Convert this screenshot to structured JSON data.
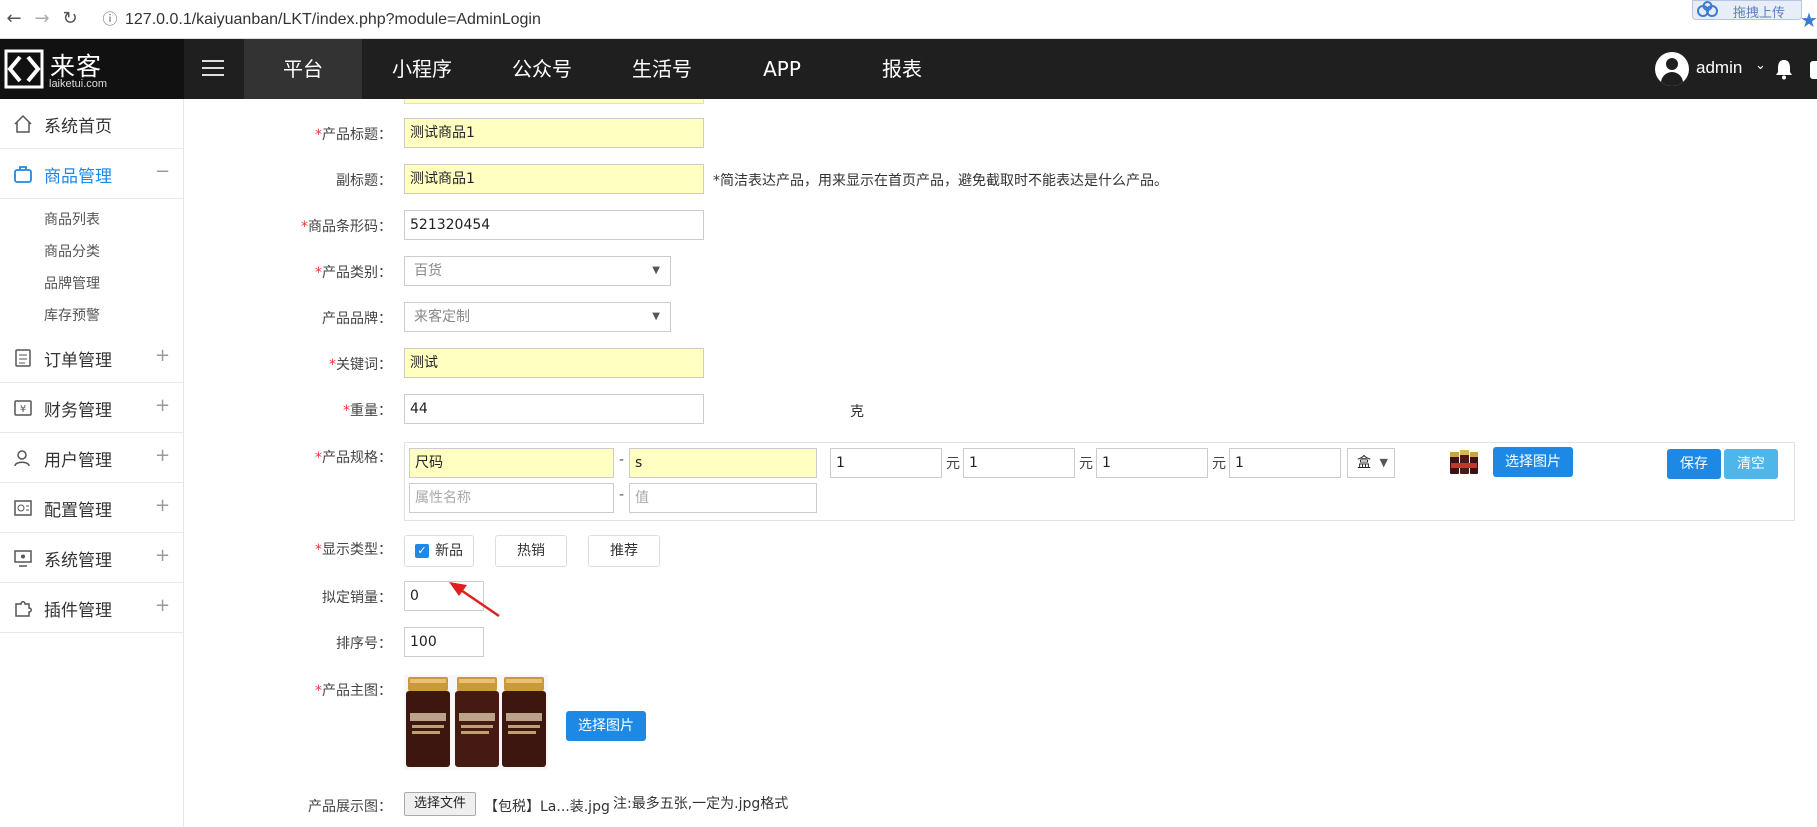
{
  "browser": {
    "url": "127.0.0.1/kaiyuanban/LKT/index.php?module=AdminLogin",
    "upload_widget_label": "拖拽上传"
  },
  "header": {
    "logo_cn": "来客",
    "logo_en": "laiketui.com",
    "nav_tabs": [
      "平台",
      "小程序",
      "公众号",
      "生活号",
      "APP",
      "报表"
    ],
    "active_tab": "平台",
    "username": "admin"
  },
  "sidebar": {
    "items": [
      {
        "label": "系统首页",
        "icon": "home-icon",
        "toggle": ""
      },
      {
        "label": "商品管理",
        "icon": "bag-icon",
        "toggle": "−"
      },
      {
        "label": "订单管理",
        "icon": "clipboard-icon",
        "toggle": "+"
      },
      {
        "label": "财务管理",
        "icon": "yen-icon",
        "toggle": "+"
      },
      {
        "label": "用户管理",
        "icon": "user-icon",
        "toggle": "+"
      },
      {
        "label": "配置管理",
        "icon": "settings-icon",
        "toggle": "+"
      },
      {
        "label": "系统管理",
        "icon": "monitor-icon",
        "toggle": "+"
      },
      {
        "label": "插件管理",
        "icon": "puzzle-icon",
        "toggle": "+"
      }
    ],
    "subitems": [
      "商品列表",
      "商品分类",
      "品牌管理",
      "库存预警"
    ]
  },
  "form": {
    "title": {
      "label": "产品标题：",
      "value": "测试商品1"
    },
    "subtitle": {
      "label": "副标题：",
      "value": "测试商品1",
      "hint": "*简洁表达产品，用来显示在首页产品，避免截取时不能表达是什么产品。"
    },
    "barcode": {
      "label": "商品条形码：",
      "value": "521320454"
    },
    "category": {
      "label": "产品类别：",
      "value": "百货"
    },
    "brand": {
      "label": "产品品牌：",
      "value": "来客定制"
    },
    "keywords": {
      "label": "关键词：",
      "value": "测试"
    },
    "weight": {
      "label": "重量：",
      "value": "44",
      "unit": "克"
    },
    "spec": {
      "label": "产品规格：",
      "attr_name": "尺码",
      "attr_value": "s",
      "attr_name_placeholder": "属性名称",
      "attr_value_placeholder": "值",
      "prices": [
        "1",
        "1",
        "1",
        "1"
      ],
      "yuan": "元",
      "unit": "盒",
      "select_image": "选择图片",
      "save": "保存",
      "clear": "清空"
    },
    "display_type": {
      "label": "显示类型：",
      "options": [
        "新品",
        "热销",
        "推荐"
      ],
      "checked": "新品"
    },
    "sales": {
      "label": "拟定销量：",
      "value": "0"
    },
    "sort": {
      "label": "排序号：",
      "value": "100"
    },
    "main_image": {
      "label": "产品主图：",
      "button": "选择图片"
    },
    "gallery": {
      "label": "产品展示图：",
      "button": "选择文件",
      "file_name": "【包税】La...装.jpg",
      "note": "注:最多五张,一定为.jpg格式"
    }
  },
  "colors": {
    "accent": "#1e88e5",
    "header_bg": "#1f1f1f",
    "highlight": "#ffffc2",
    "required": "#e33333"
  }
}
